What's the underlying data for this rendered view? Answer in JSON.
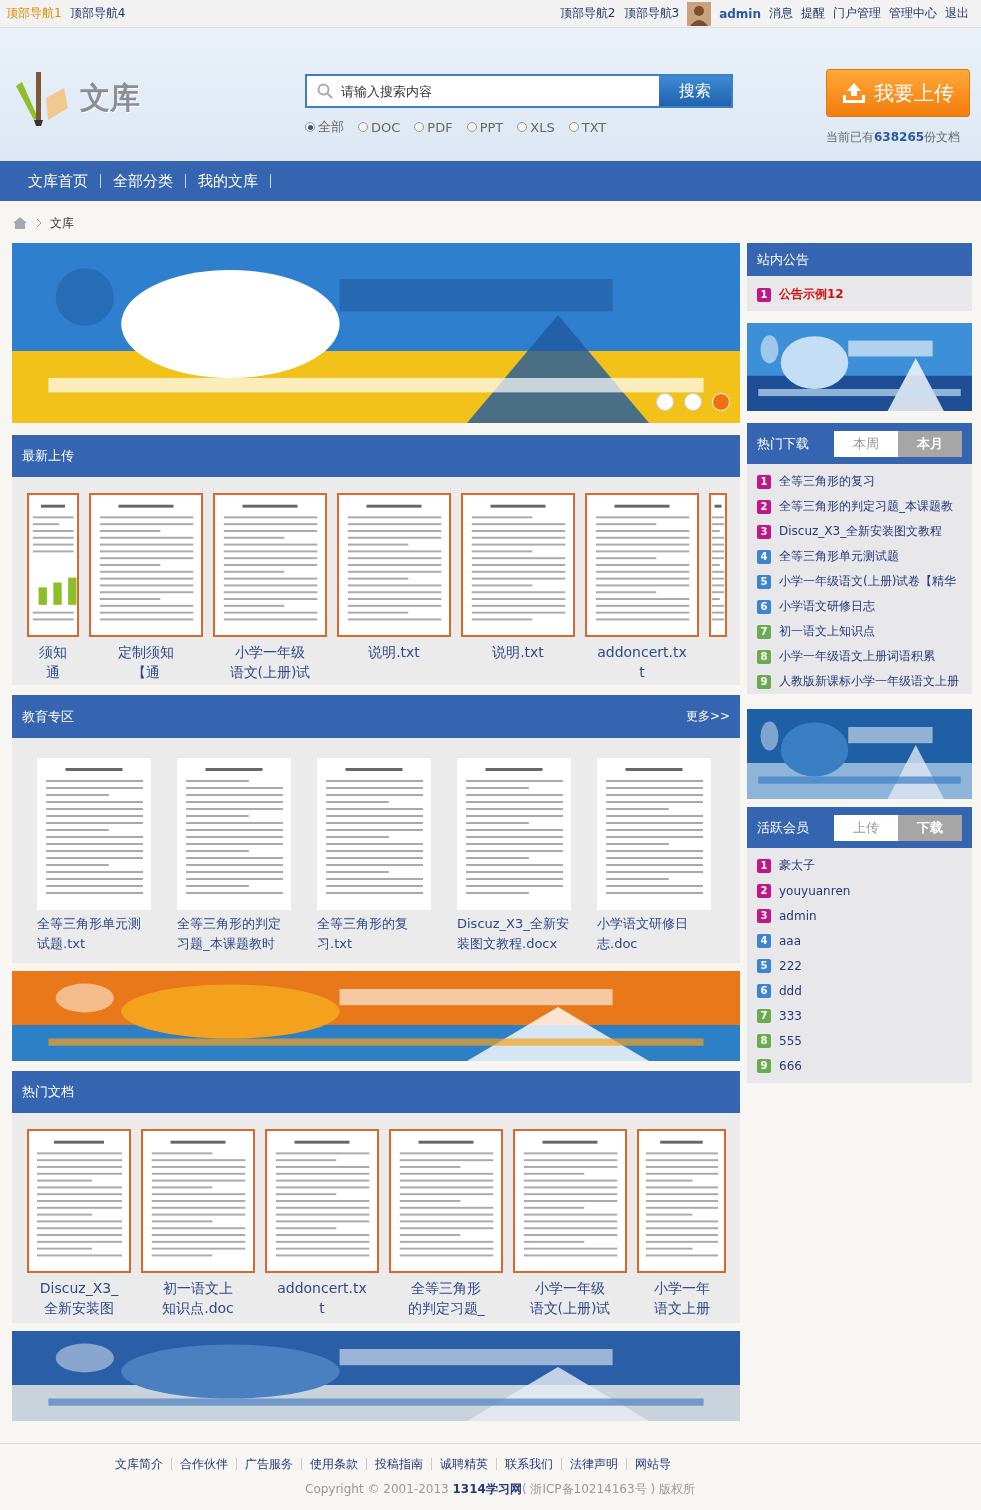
{
  "top_bar": {
    "left_links": [
      {
        "label": "顶部导航1",
        "selected": true
      },
      {
        "label": "顶部导航4",
        "selected": false
      }
    ],
    "right_links": [
      {
        "label": "顶部导航2",
        "kind": "link"
      },
      {
        "label": "顶部导航3",
        "kind": "link"
      },
      {
        "label": "admin",
        "kind": "user"
      },
      {
        "label": "消息",
        "kind": "link"
      },
      {
        "label": "提醒",
        "kind": "link"
      },
      {
        "label": "门户管理",
        "kind": "link"
      },
      {
        "label": "管理中心",
        "kind": "link"
      },
      {
        "label": "退出",
        "kind": "link"
      }
    ]
  },
  "header": {
    "logo_text": "文库",
    "search": {
      "placeholder": "请输入搜索内容",
      "button": "搜索"
    },
    "file_types": [
      {
        "label": "全部",
        "selected": true
      },
      {
        "label": "DOC",
        "selected": false
      },
      {
        "label": "PDF",
        "selected": false
      },
      {
        "label": "PPT",
        "selected": false
      },
      {
        "label": "XLS",
        "selected": false
      },
      {
        "label": "TXT",
        "selected": false
      }
    ],
    "upload_button": "我要上传",
    "doc_count": "当前已有**638265**份文档"
  },
  "nav": [
    "文库首页",
    "全部分类",
    "我的文库"
  ],
  "breadcrumb": [
    "文库"
  ],
  "left_column": [
    {
      "kind": "banner",
      "dots": [
        {
          "selected": false
        },
        {
          "selected": false
        },
        {
          "selected": true
        }
      ]
    },
    {
      "kind": "doc-strip",
      "title": "最新上传",
      "items": [
        {
          "kind": "cut-left",
          "caption": [
            "须知",
            "通"
          ]
        },
        {
          "kind": "full",
          "caption": [
            "定制须知",
            "【通"
          ]
        },
        {
          "kind": "full",
          "caption": [
            "小学一年级",
            "语文(上册)试"
          ]
        },
        {
          "kind": "full",
          "caption": [
            "说明.txt"
          ]
        },
        {
          "kind": "full",
          "caption": [
            "说明.txt"
          ]
        },
        {
          "kind": "full",
          "caption": [
            "addoncert.tx",
            "t"
          ]
        },
        {
          "kind": "cut-right"
        }
      ]
    },
    {
      "kind": "doc-grid",
      "title": "教育专区",
      "more": "更多>>",
      "items": [
        {
          "caption": [
            "全等三角形单元测",
            "试题.txt"
          ]
        },
        {
          "caption": [
            "全等三角形的判定",
            "习题_本课题教时"
          ]
        },
        {
          "caption": [
            "全等三角形的复",
            "习.txt"
          ]
        },
        {
          "caption": [
            "Discuz_X3_全新安",
            "装图文教程.docx"
          ]
        },
        {
          "caption": [
            "小学语文研修日",
            "志.doc"
          ]
        }
      ]
    },
    {
      "kind": "ad"
    },
    {
      "kind": "doc-strip",
      "title": "热门文档",
      "items": [
        {
          "kind": "cut-left",
          "caption": [
            "Discuz_X3_",
            "全新安装图"
          ]
        },
        {
          "kind": "full",
          "caption": [
            "初一语文上",
            "知识点.doc"
          ]
        },
        {
          "kind": "full",
          "caption": [
            "addoncert.tx",
            "t"
          ]
        },
        {
          "kind": "full",
          "caption": [
            "全等三角形",
            "的判定习题_"
          ]
        },
        {
          "kind": "full",
          "caption": [
            "小学一年级",
            "语文(上册)试"
          ]
        },
        {
          "kind": "cut-right",
          "caption": [
            "小学一年",
            "语文上册"
          ]
        }
      ]
    },
    {
      "kind": "ad"
    }
  ],
  "right_column": [
    {
      "kind": "notice",
      "title": "站内公告",
      "items": [
        {
          "num": "1",
          "label": "公告示例12",
          "color": "#c0168a"
        }
      ]
    },
    {
      "kind": "ad"
    },
    {
      "kind": "ranked",
      "title": "热门下载",
      "tabs": [
        {
          "label": "本周",
          "selected": false
        },
        {
          "label": "本月",
          "selected": true
        }
      ],
      "items": [
        {
          "num": "1",
          "label": "全等三角形的复习",
          "color": "#c0168a"
        },
        {
          "num": "2",
          "label": "全等三角形的判定习题_本课题教",
          "color": "#c0168a"
        },
        {
          "num": "3",
          "label": "Discuz_X3_全新安装图文教程",
          "color": "#c0168a"
        },
        {
          "num": "4",
          "label": "全等三角形单元测试题",
          "color": "#3d85d0"
        },
        {
          "num": "5",
          "label": "小学一年级语文(上册)试卷【精华",
          "color": "#3d85d0"
        },
        {
          "num": "6",
          "label": "小学语文研修日志",
          "color": "#3d85d0"
        },
        {
          "num": "7",
          "label": "初一语文上知识点",
          "color": "#6aaa50"
        },
        {
          "num": "8",
          "label": "小学一年级语文上册词语积累",
          "color": "#6aaa50"
        },
        {
          "num": "9",
          "label": "人教版新课标小学一年级语文上册",
          "color": "#6aaa50"
        }
      ]
    },
    {
      "kind": "ad"
    },
    {
      "kind": "ranked",
      "title": "活跃会员",
      "tabs": [
        {
          "label": "上传",
          "selected": false
        },
        {
          "label": "下载",
          "selected": true
        }
      ],
      "items": [
        {
          "num": "1",
          "label": "豪太子",
          "color": "#c0168a"
        },
        {
          "num": "2",
          "label": "youyuanren",
          "color": "#c0168a"
        },
        {
          "num": "3",
          "label": "admin",
          "color": "#c0168a"
        },
        {
          "num": "4",
          "label": "aaa",
          "color": "#3d85d0"
        },
        {
          "num": "5",
          "label": "222",
          "color": "#3d85d0"
        },
        {
          "num": "6",
          "label": "ddd",
          "color": "#3d85d0"
        },
        {
          "num": "7",
          "label": "333",
          "color": "#6aaa50"
        },
        {
          "num": "8",
          "label": "555",
          "color": "#6aaa50"
        },
        {
          "num": "9",
          "label": "666",
          "color": "#6aaa50"
        }
      ]
    }
  ],
  "footer": {
    "links": [
      "文库简介",
      "合作伙伴",
      "广告服务",
      "使用条款",
      "投稿指南",
      "诚聘精英",
      "联系我们",
      "法律声明",
      "网站导"
    ],
    "copyright": "Copyright © 2001-2013 **1314学习网**( 浙ICP备10214163号 ) 版权所"
  }
}
